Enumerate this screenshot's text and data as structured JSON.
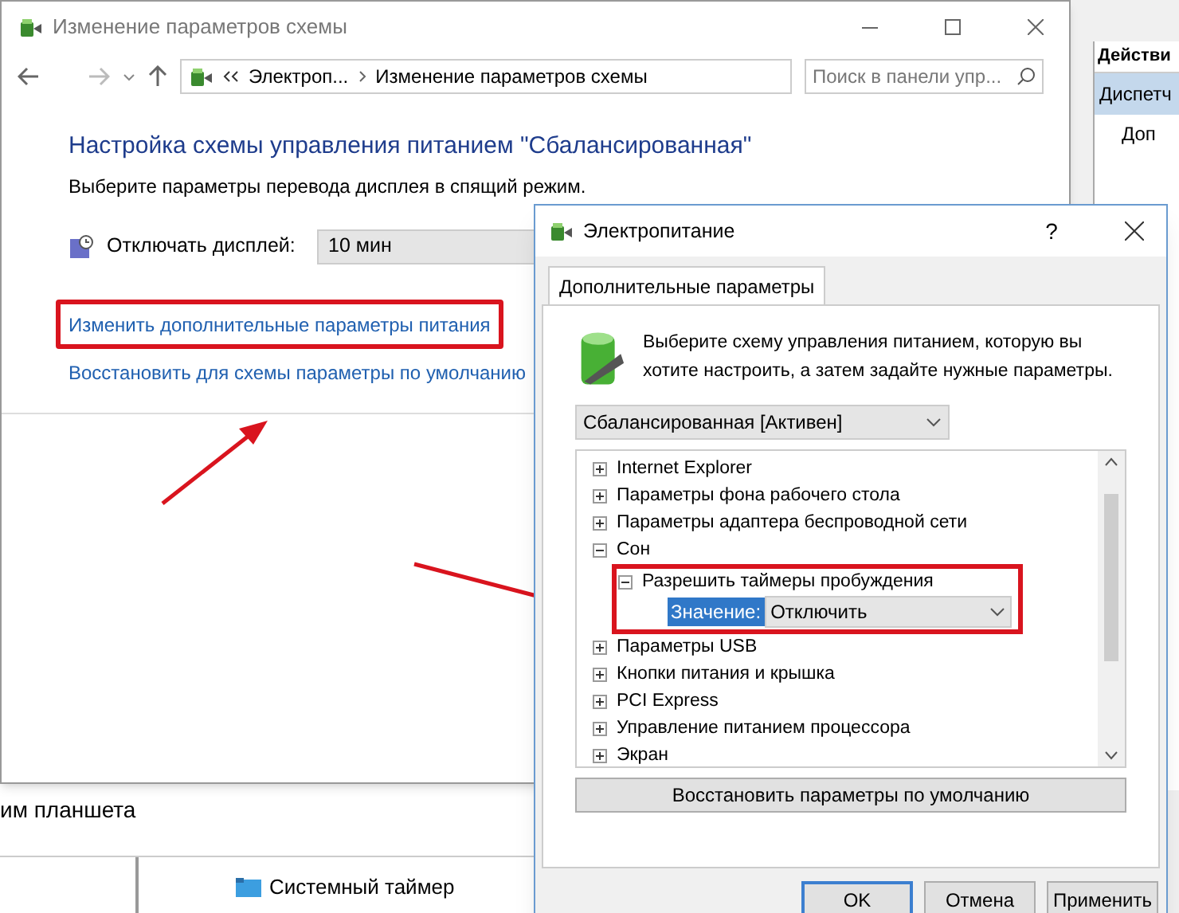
{
  "background_window": {
    "actions_header": "Действи",
    "actions_item": "Диспетч",
    "actions_subitem": "Доп",
    "tablet_text": "им планшета",
    "devices": [
      {
        "label": "Системный таймер"
      }
    ]
  },
  "main_window": {
    "title": "Изменение параметров схемы",
    "breadcrumb": [
      "Электроп...",
      "Изменение параметров схемы"
    ],
    "search": {
      "placeholder": "Поиск в панели упр..."
    },
    "heading": "Настройка схемы управления питанием \"Сбалансированная\"",
    "subtitle": "Выберите параметры перевода дисплея в спящий режим.",
    "display_off": {
      "label": "Отключать дисплей:",
      "value": "10 мин"
    },
    "links": [
      {
        "label": "Изменить дополнительные параметры питания",
        "highlighted": true
      },
      {
        "label": "Восстановить для схемы параметры по умолчанию",
        "highlighted": false
      }
    ]
  },
  "dialog": {
    "title": "Электропитание",
    "help": "?",
    "tabs": [
      {
        "label": "Дополнительные параметры",
        "selected": true
      }
    ],
    "description": "Выберите схему управления питанием, которую вы хотите настроить, а затем задайте нужные параметры.",
    "scheme": "Сбалансированная [Активен]",
    "tree": [
      {
        "label": "Internet Explorer",
        "expanded": false
      },
      {
        "label": "Параметры фона рабочего стола",
        "expanded": false
      },
      {
        "label": "Параметры адаптера беспроводной сети",
        "expanded": false
      },
      {
        "label": "Сон",
        "expanded": true,
        "children": [
          {
            "label": "Разрешить таймеры пробуждения",
            "expanded": true,
            "highlighted": true,
            "setting": {
              "label": "Значение:",
              "value": "Отключить"
            }
          }
        ]
      },
      {
        "label": "Параметры USB",
        "expanded": false
      },
      {
        "label": "Кнопки питания и крышка",
        "expanded": false
      },
      {
        "label": "PCI Express",
        "expanded": false
      },
      {
        "label": "Управление питанием процессора",
        "expanded": false
      },
      {
        "label": "Экран",
        "expanded": false
      }
    ],
    "restore_button": "Восстановить параметры по умолчанию",
    "buttons": [
      {
        "label": "OK",
        "default": true
      },
      {
        "label": "Отмена",
        "default": false
      },
      {
        "label": "Применить",
        "default": false
      }
    ]
  }
}
